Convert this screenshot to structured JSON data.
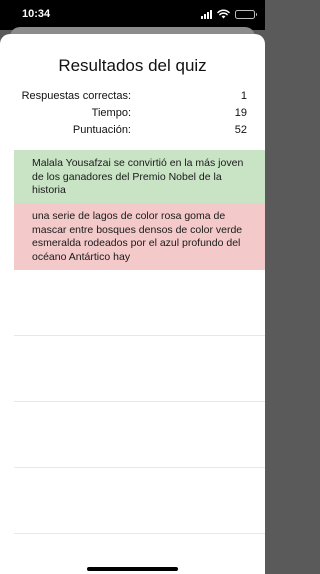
{
  "status_bar": {
    "time": "10:34"
  },
  "quiz": {
    "title": "Resultados del quiz",
    "stats": [
      {
        "label": "Respuestas correctas:",
        "value": "1"
      },
      {
        "label": "Tiempo:",
        "value": "19"
      },
      {
        "label": "Puntuación:",
        "value": "52"
      }
    ],
    "answers": [
      {
        "text": "Malala Yousafzai se convirtió en la más joven de los ganadores del Premio Nobel de la historia",
        "result": "correct",
        "color": "#c9e3c5"
      },
      {
        "text": "una serie de lagos de color rosa goma de mascar entre bosques densos de color verde esmeralda rodeados por el azul profundo del océano Antártico hay",
        "result": "incorrect",
        "color": "#f3c9ca"
      }
    ]
  }
}
